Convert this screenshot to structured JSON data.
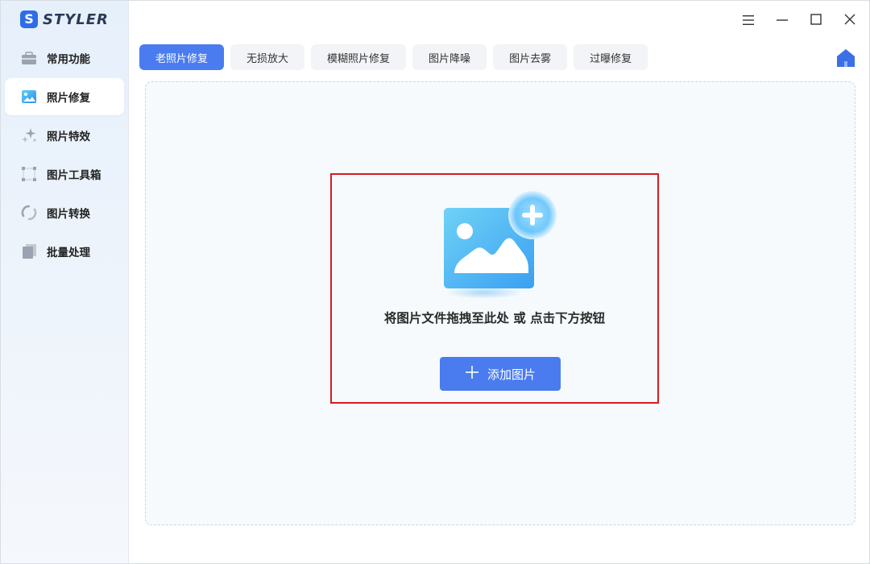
{
  "app": {
    "name": "STYLER",
    "logo_letter": "S"
  },
  "sidebar": {
    "items": [
      {
        "label": "常用功能",
        "icon": "toolbox-icon"
      },
      {
        "label": "照片修复",
        "icon": "photo-icon",
        "active": true
      },
      {
        "label": "照片特效",
        "icon": "sparkle-icon"
      },
      {
        "label": "图片工具箱",
        "icon": "crop-frame-icon"
      },
      {
        "label": "图片转换",
        "icon": "convert-icon"
      },
      {
        "label": "批量处理",
        "icon": "stack-icon"
      }
    ]
  },
  "tabs": [
    {
      "label": "老照片修复",
      "active": true
    },
    {
      "label": "无损放大"
    },
    {
      "label": "模糊照片修复"
    },
    {
      "label": "图片降噪"
    },
    {
      "label": "图片去雾"
    },
    {
      "label": "过曝修复"
    }
  ],
  "dropzone": {
    "hint": "将图片文件拖拽至此处 或 点击下方按钮",
    "button_label": "添加图片"
  },
  "colors": {
    "accent": "#4a7cf0",
    "highlight": "#d41c22",
    "logo": "#2f6de8"
  }
}
